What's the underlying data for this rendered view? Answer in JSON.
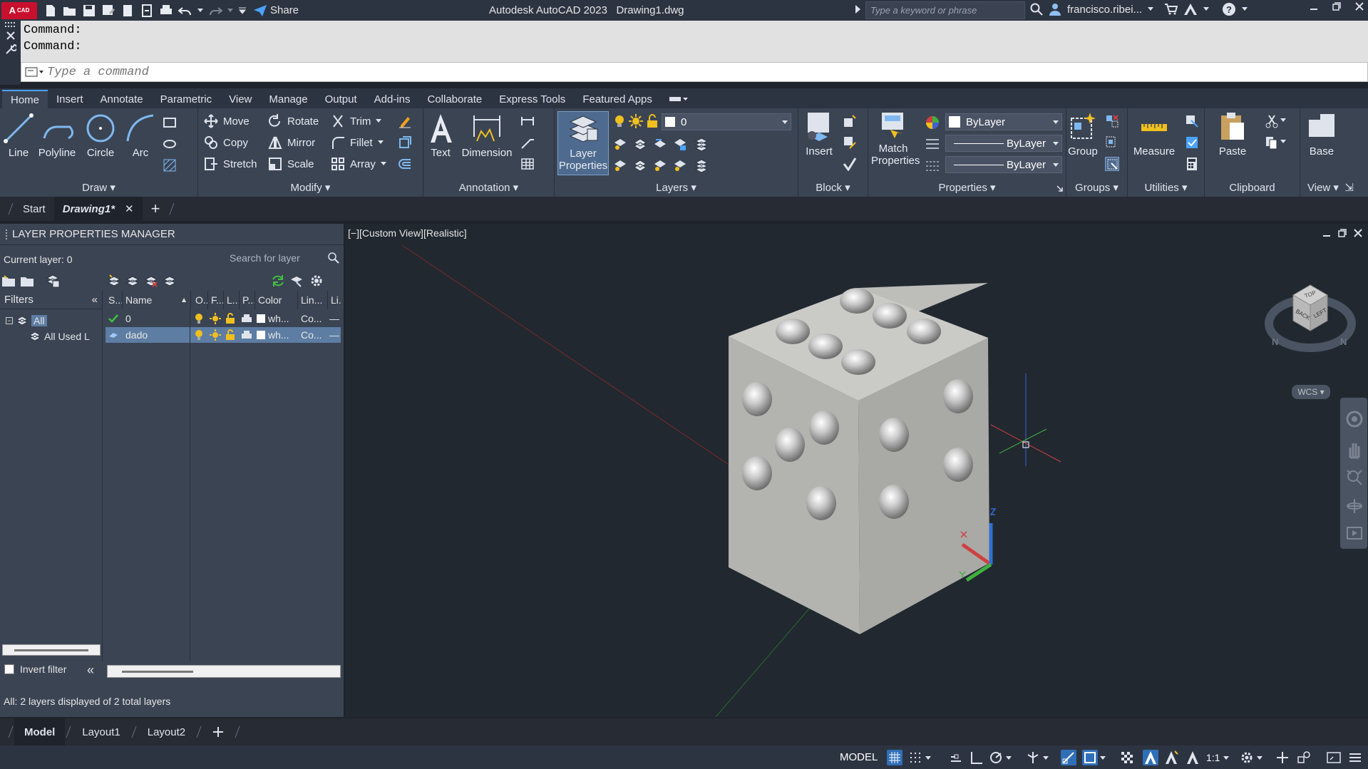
{
  "titlebar": {
    "logo_main": "A",
    "logo_sub": "CAD",
    "share_label": "Share",
    "app_name": "Autodesk AutoCAD 2023",
    "file_name": "Drawing1.dwg",
    "search_placeholder": "Type a keyword or phrase",
    "user_name": "francisco.ribei...",
    "help_label": "?"
  },
  "command": {
    "history": [
      "Command:",
      "Command:"
    ],
    "input_placeholder": "Type a command"
  },
  "ribbon_tabs": [
    "Home",
    "Insert",
    "Annotate",
    "Parametric",
    "View",
    "Manage",
    "Output",
    "Add-ins",
    "Collaborate",
    "Express Tools",
    "Featured Apps"
  ],
  "ribbon": {
    "draw": {
      "label": "Draw",
      "line": "Line",
      "polyline": "Polyline",
      "circle": "Circle",
      "arc": "Arc"
    },
    "modify": {
      "label": "Modify",
      "move": "Move",
      "rotate": "Rotate",
      "trim": "Trim",
      "copy": "Copy",
      "mirror": "Mirror",
      "fillet": "Fillet",
      "stretch": "Stretch",
      "scale": "Scale",
      "array": "Array"
    },
    "annotation": {
      "label": "Annotation",
      "text": "Text",
      "dimension": "Dimension"
    },
    "layers": {
      "label": "Layers",
      "layer_properties_line1": "Layer",
      "layer_properties_line2": "Properties",
      "current_layer": "0"
    },
    "block": {
      "label": "Block",
      "insert": "Insert"
    },
    "properties": {
      "label": "Properties",
      "match_line1": "Match",
      "match_line2": "Properties",
      "color": "ByLayer",
      "linetype": "ByLayer",
      "lineweight": "ByLayer"
    },
    "groups": {
      "label": "Groups",
      "group": "Group"
    },
    "utilities": {
      "label": "Utilities",
      "measure": "Measure"
    },
    "clipboard": {
      "label": "Clipboard",
      "paste": "Paste"
    },
    "view": {
      "label": "View",
      "base": "Base"
    }
  },
  "file_tabs": {
    "start": "Start",
    "drawing": "Drawing1*",
    "close": "✕",
    "add": "+"
  },
  "layer_manager": {
    "title": "LAYER PROPERTIES MANAGER",
    "current_layer": "Current layer: 0",
    "search_placeholder": "Search for layer",
    "filters_label": "Filters",
    "tree_all": "All",
    "tree_all_used": "All Used L",
    "columns": [
      "S...",
      "Name",
      "O..",
      "F...",
      "L...",
      "P...",
      "Color",
      "Lin...",
      "Li."
    ],
    "layers": [
      {
        "name": "0",
        "color": "wh...",
        "linetype": "Co...",
        "lineweight": "—",
        "current": true
      },
      {
        "name": "dado",
        "color": "wh...",
        "linetype": "Co...",
        "lineweight": "—",
        "current": false
      }
    ],
    "invert_filter": "Invert filter",
    "status": "All: 2 layers displayed of 2 total layers"
  },
  "viewport": {
    "label": "[−][Custom View][Realistic]",
    "viewcube_top": "TOP",
    "viewcube_back": "BACK",
    "viewcube_left": "LEFT",
    "compass_n1": "N",
    "compass_n2": "N",
    "wcs": "WCS"
  },
  "layout_tabs": [
    "Model",
    "Layout1",
    "Layout2"
  ],
  "statusbar": {
    "model": "MODEL",
    "scale": "1:1"
  },
  "colors": {
    "accent": "#4aa3ff",
    "ribbon_bg": "#3b4453",
    "titlebar_bg": "#2d3441",
    "viewport_bg": "#212830",
    "selection": "#5d7da3"
  }
}
